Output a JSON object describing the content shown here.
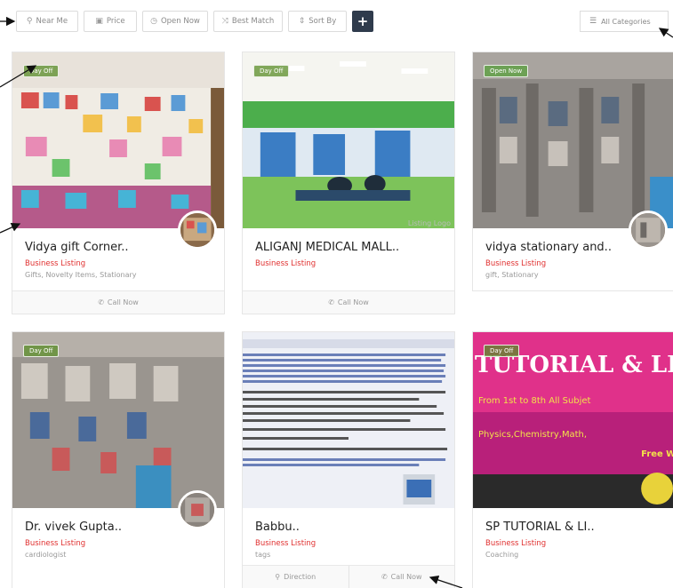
{
  "filters": [
    {
      "label": "Near Me",
      "icon": "map-pin-icon",
      "glyph": "⚲"
    },
    {
      "label": "Price",
      "icon": "money-icon",
      "glyph": "▣"
    },
    {
      "label": "Open Now",
      "icon": "clock-icon",
      "glyph": "◷"
    },
    {
      "label": "Best Match",
      "icon": "shuffle-icon",
      "glyph": "⤨"
    },
    {
      "label": "Sort By",
      "icon": "sort-icon",
      "glyph": "⇕"
    }
  ],
  "add_label": "+",
  "category_select": {
    "label": "All Categories",
    "icon": "list-icon"
  },
  "call_label": "Call Now",
  "direction_label": "Direction",
  "listings": [
    {
      "title": "Vidya gift Corner..",
      "type": "Business Listing",
      "categories": "Gifts, Novelty Items, Stationary",
      "tag": "Day Off"
    },
    {
      "title": "ALIGANJ MEDICAL MALL..",
      "type": "Business Listing",
      "categories": "",
      "tag": "Day Off",
      "watermark": "Listing Logo"
    },
    {
      "title": "vidya stationary and..",
      "type": "Business Listing",
      "categories": "gift, Stationary",
      "tag": "Open Now"
    },
    {
      "title": "Dr. vivek Gupta..",
      "type": "Business Listing",
      "categories": "cardiologist",
      "tag": "Day Off"
    },
    {
      "title": "Babbu..",
      "type": "Business Listing",
      "categories": "tags",
      "tag": ""
    },
    {
      "title": "SP TUTORIAL & LI..",
      "type": "Business Listing",
      "categories": "Coaching",
      "tag": "Day Off",
      "banner_text": "TUTORIAL & LIBR"
    }
  ],
  "colors": {
    "accent_red": "#e0302f",
    "dark_button": "#2f3b4c",
    "tag_green": "#5a8c28"
  }
}
